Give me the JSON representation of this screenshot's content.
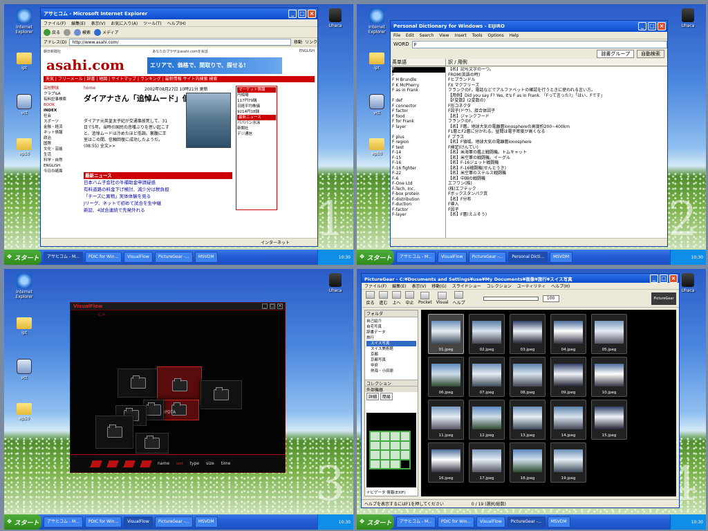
{
  "desktop": {
    "icons": [
      {
        "label": "Internet Explorer",
        "icon": "internet-explorer-icon"
      },
      {
        "label": "ipt",
        "icon": "folder-icon"
      },
      {
        "label": "vct",
        "icon": "my-computer-icon"
      },
      {
        "label": "ep10",
        "icon": "folder-icon"
      }
    ],
    "right_icon": {
      "label": "Uhaca",
      "icon": "uhaca-icon"
    },
    "quadrant_numbers": [
      "1",
      "2",
      "3",
      "4"
    ]
  },
  "taskbar": {
    "start_label": "スタート",
    "buttons": [
      "アサヒコム - M...",
      "PDIC for Win...",
      "VisualFlow",
      "PictureGear -...",
      "MSVDM",
      "Personal Dicti..."
    ],
    "clock": "10:30"
  },
  "ie": {
    "title": "アサヒコム - Microsoft Internet Explorer",
    "menu": [
      "ファイル(F)",
      "編集(E)",
      "表示(V)",
      "お気に入り(A)",
      "ツール(T)",
      "ヘルプ(H)"
    ],
    "toolbar": [
      "戻る",
      "検索",
      "メディア"
    ],
    "address_label": "アドレス(D)",
    "address": "http://www.asahi.com/",
    "go": "移動",
    "links": "リンク",
    "status": "インターネット",
    "page": {
      "top_left": "朝日新聞社",
      "top_mid": "あなたのプラザはasahi.comを会話",
      "top_right": "ENGLISH",
      "logo": "asahi.com",
      "banner": "エリアで、価格で、間取りで、探せる!",
      "nav": "天気 | フリーメール | 辞書 | 地図 | サイトマップ | ランキング | 最新情報   サイト内検索   検索",
      "left_items": [
        "高校野球",
        "クラブ&A",
        "有料記事検索",
        "BOOK",
        "INDEX",
        "社会",
        "スポーツ",
        "金融・経済",
        "ネット情報",
        "政治",
        "国際",
        "文化・芸能",
        "生活",
        "科学・自然",
        "ENGLISH",
        "今日の紙面"
      ],
      "home": "home",
      "date": "2002年08月27日 10時21分 更新",
      "headline": "ダイアナさん「追悼ムード」低調",
      "lead": "ダイアナ元英皇太子妃が交通事故死して、31日で5年。当時の国民の悲嘆ぶりを思い起こすと、追悼ムードは冷めたほど低調。裏腹に王室はこの間、信頼回復に成功したようだ。(08:55) 全文>>",
      "market_title": "マーケット情報",
      "market_items": [
        "円相場",
        "117円79銭",
        "日経平均株価",
        "9214円18銭",
        "最新ニュース",
        "パパパン水泳",
        "新聞社",
        "デジ通信"
      ],
      "news_title": "最新ニュース",
      "news": [
        "日本ハム子会社の牛補助金申請疑惑",
        "有料道路の料金下げ検討、減少分は税負担",
        "「チーズに異物」実体体験を見る",
        "Jリーグ、ネットで初めて試合を生中継",
        "新証、4試合連続で先発外れる"
      ]
    }
  },
  "dict": {
    "title": "Personal Dictionary for Windows - EIJIRO",
    "menu": [
      "File",
      "Edit",
      "Search",
      "View",
      "Insert",
      "Tools",
      "Options",
      "Help"
    ],
    "word_label": "WORD",
    "word_value": "F",
    "tabs": [
      "辞書グループ",
      "自動検索"
    ],
    "col_headers": [
      "英単語",
      "訳 / 用例"
    ],
    "entries": [
      [
        "F",
        "【名】記号文字の一つ。"
      ],
      [
        "F",
        "FROM(英語の時)"
      ],
      [
        "F H Brundle",
        "Fヒブランドル"
      ],
      [
        "F K McPherry",
        "FX マクフリーズ"
      ],
      [
        "F as in Frank",
        "フランクのF。電話などでアルファベットの確認を行うときに使われる言い方。"
      ],
      [
        "",
        "【用例】Did you say F? Yes, It's F as in Frank. 「Fって言った?」「はい、Fです」"
      ],
      [
        "F def",
        "【F変数】(2変数の)"
      ],
      [
        "F connector",
        "F形コネクタ"
      ],
      [
        "F factor",
        "F因子(ドウ)、接合体因子"
      ],
      [
        "F food",
        "【名】ジャンクフード"
      ],
      [
        "F for Frank",
        "フランクのF。"
      ],
      [
        "F layer",
        "【名】F層。地球大気の電離層ionosphereの高度約200~400km"
      ],
      [
        "",
        "F1層とF2層に分かれる。昼間は電子密度が高くなる"
      ],
      [
        "F plus",
        "F プラス"
      ],
      [
        "F region",
        "【名】F領域。地球大気の電離層ionosphere"
      ],
      [
        "F test",
        "F検定(けんてい)"
      ],
      [
        "F-14",
        "【名】米海軍の艦上戦闘機。トムキャット"
      ],
      [
        "F-15",
        "【名】米空軍の戦闘機。イーグル"
      ],
      [
        "F-16",
        "【名】F-16ジェット戦闘機"
      ],
      [
        "F-16 fighter",
        "【名】F-16戦闘機(せんとうき)"
      ],
      [
        "F-22",
        "【名】米空軍のステルス戦闘機"
      ],
      [
        "F-6",
        "【名】中国の戦闘機"
      ],
      [
        "F-One Ltd",
        "エフワン(株)"
      ],
      [
        "F-Tech, Inc.",
        "(株)エフテック"
      ],
      [
        "F-box protein",
        "Fボックスタンパク質"
      ],
      [
        "F-distribution",
        "【名】F分布"
      ],
      [
        "F-duction",
        "F導入"
      ],
      [
        "F-factor",
        "F因子"
      ],
      [
        "F-layer",
        "【名】F層(えふそう)"
      ]
    ],
    "status": ""
  },
  "visualflow": {
    "title": "VisualFlow",
    "header": "C:¥",
    "selected_label": "HPDTA",
    "bar_labels": [
      "name",
      "type",
      "size",
      "time"
    ],
    "sort_label": "sort"
  },
  "picturegear": {
    "title": "PictureGear - C:¥Documents and Settings¥use¥My Documents¥画像¥旅行¥スイス写真",
    "menu": [
      "ファイル(F)",
      "編集(E)",
      "表示(V)",
      "移動(G)",
      "スライドショー",
      "コレクション",
      "ユーティリティ",
      "ヘルプ(H)"
    ],
    "tools": [
      "戻る",
      "進む",
      "上へ",
      "中止",
      "Pocket",
      "Visual",
      "ヘルプ"
    ],
    "zoom": "100",
    "brand": "PictureGear",
    "folder_header": "フォルダ",
    "folders": [
      "自己紹介",
      "自宅写真",
      "辞書データ",
      "旅行",
      "スイス写真",
      "スイス美術館",
      "京都",
      "京都写真",
      "甲府",
      "熱海・小田原"
    ],
    "panel_buttons": [
      "コレクション",
      "外部機器"
    ],
    "panel_tabs": [
      "詳細",
      "簡易"
    ],
    "nav_tabs": [
      "ナビゲータ",
      "情報(EXIF)"
    ],
    "thumbnails": [
      "01.jpeg",
      "02.jpeg",
      "03.jpeg",
      "04.jpeg",
      "05.jpeg",
      "06.jpeg",
      "07.jpeg",
      "08.jpeg",
      "09.jpeg",
      "10.jpeg",
      "11.jpeg",
      "12.jpeg",
      "13.jpeg",
      "14.jpeg",
      "15.jpeg",
      "16.jpeg",
      "17.jpeg",
      "18.jpeg",
      "19.jpeg"
    ],
    "status_left": "ヘルプを表示するにはF1を押してください",
    "status_count": "0 / 19 (選択/総数)"
  }
}
